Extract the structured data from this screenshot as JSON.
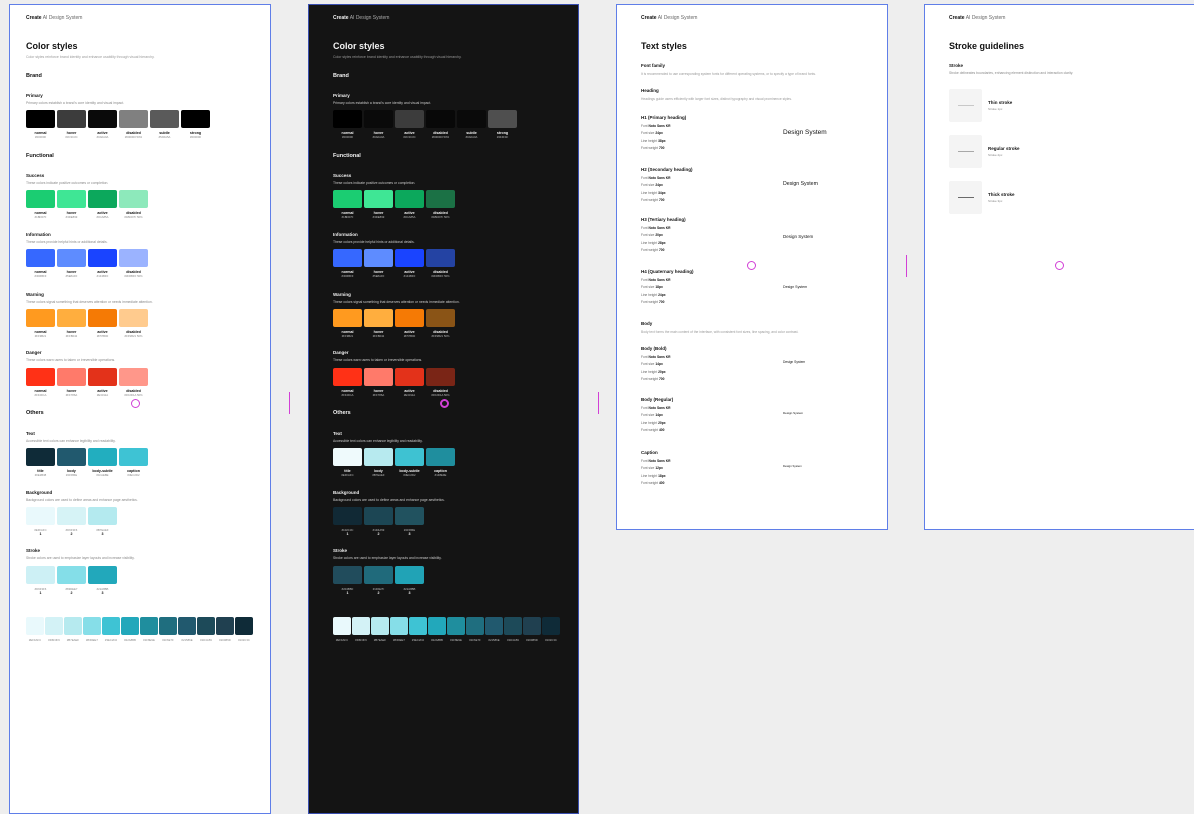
{
  "breadcrumb": {
    "brand": "Create",
    "path": "AI Design System"
  },
  "color": {
    "title": "Color styles",
    "subtitle": "Color styles reinforce brand identity and enhance usability through visual hierarchy.",
    "brand_title": "Brand",
    "functional_title": "Functional",
    "others_title": "Others"
  },
  "light": {
    "primary": {
      "name": "Primary",
      "desc": "Primary colors establish a brand's core identity and visual impact.",
      "swatches": [
        {
          "label": "normal",
          "hex": "#000000",
          "color": "#000000"
        },
        {
          "label": "hover",
          "hex": "#3C3C3C",
          "color": "#3c3c3c"
        },
        {
          "label": "active",
          "hex": "#0A0A0A",
          "color": "#0a0a0a"
        },
        {
          "label": "disabled",
          "hex": "#000000 50%",
          "color": "#808080"
        },
        {
          "label": "subtle",
          "hex": "#5A5A5A",
          "color": "#5a5a5a"
        },
        {
          "label": "strong",
          "hex": "#000000",
          "color": "#000000"
        }
      ]
    },
    "success": {
      "name": "Success",
      "desc": "These colors indicate positive outcomes or completion.",
      "swatches": [
        {
          "label": "normal",
          "hex": "#1BD07F",
          "color": "#1bcd72"
        },
        {
          "label": "hover",
          "hex": "#3DE899",
          "color": "#3fe695"
        },
        {
          "label": "active",
          "hex": "#0CA85A",
          "color": "#0ca85c"
        },
        {
          "label": "disabled",
          "hex": "#1BD07F 50%",
          "color": "#8de9bb"
        }
      ]
    },
    "information": {
      "name": "Information",
      "desc": "These colors provide helpful hints or additional details.",
      "swatches": [
        {
          "label": "normal",
          "hex": "#3D6BFF",
          "color": "#3668ff"
        },
        {
          "label": "hover",
          "hex": "#5E8AFF",
          "color": "#5e8cff"
        },
        {
          "label": "active",
          "hex": "#1F4BFF",
          "color": "#1a44ff"
        },
        {
          "label": "disabled",
          "hex": "#3D6BFF 50%",
          "color": "#9bb3ff"
        }
      ]
    },
    "warning": {
      "name": "Warning",
      "desc": "These colors signal something that deserves attention or needs immediate attention.",
      "swatches": [
        {
          "label": "normal",
          "hex": "#FF9B21",
          "color": "#ff9a1f"
        },
        {
          "label": "hover",
          "hex": "#FFB042",
          "color": "#ffae3e"
        },
        {
          "label": "active",
          "hex": "#F57B00",
          "color": "#f57a05"
        },
        {
          "label": "disabled",
          "hex": "#FF9B21 50%",
          "color": "#ffcb8e"
        }
      ]
    },
    "danger": {
      "name": "Danger",
      "desc": "These colors warn users to taken or irreversible operations.",
      "swatches": [
        {
          "label": "normal",
          "hex": "#FF2D1A",
          "color": "#ff3116"
        },
        {
          "label": "hover",
          "hex": "#FF786A",
          "color": "#ff7a6a"
        },
        {
          "label": "active",
          "hex": "#E3311A",
          "color": "#e3321a"
        },
        {
          "label": "disabled",
          "hex": "#FF2D1A 50%",
          "color": "#ff978a"
        }
      ]
    },
    "text": {
      "name": "Text",
      "desc": "Accessible text colors can enhance legibility and readability.",
      "swatches": [
        {
          "label": "title",
          "hex": "#0E2B38",
          "color": "#0f2b38"
        },
        {
          "label": "body",
          "hex": "#21586E",
          "color": "#21596e"
        },
        {
          "label": "body-subtle",
          "hex": "#1FAEBE",
          "color": "#22aebf"
        },
        {
          "label": "caption",
          "hex": "#3EC2D2",
          "color": "#3ec3d4"
        }
      ]
    },
    "background": {
      "name": "Background",
      "desc": "Background colors are used to define areas and enhance page aesthetics.",
      "swatches": [
        {
          "label": "1",
          "hex": "#EFFAFC",
          "color": "#e9f9fc"
        },
        {
          "label": "2",
          "hex": "#D6F3F6",
          "color": "#d6f3f6"
        },
        {
          "label": "3",
          "hex": "#B7EAEF",
          "color": "#b4eaef"
        }
      ]
    },
    "stroke": {
      "name": "Stroke",
      "desc": "Stroke colors are used to emphasize layer layouts and increase visibility.",
      "swatches": [
        {
          "label": "1",
          "hex": "#D6F3F6",
          "color": "#cdf0f5"
        },
        {
          "label": "2",
          "hex": "#83DEE7",
          "color": "#84dee8"
        },
        {
          "label": "3",
          "hex": "#22A8BB",
          "color": "#22a8bb"
        }
      ]
    }
  },
  "dark": {
    "primary": {
      "name": "Primary",
      "desc": "Primary colors establish a brand's core identity and visual impact.",
      "swatches": [
        {
          "label": "normal",
          "hex": "#000000",
          "color": "#000000"
        },
        {
          "label": "hover",
          "hex": "#0A0A0A",
          "color": "#0a0a0a"
        },
        {
          "label": "active",
          "hex": "#3C3C3C",
          "color": "#3c3c3c"
        },
        {
          "label": "disabled",
          "hex": "#000000 50%",
          "color": "#080808"
        },
        {
          "label": "subtle",
          "hex": "#0A0A0A",
          "color": "#0a0a0a"
        },
        {
          "label": "strong",
          "hex": "#4F4F4F",
          "color": "#4f4f4f"
        }
      ]
    },
    "success": {
      "name": "Success",
      "desc": "These colors indicate positive outcomes or completion.",
      "swatches": [
        {
          "label": "normal",
          "hex": "#1BD07F",
          "color": "#1bcd72"
        },
        {
          "label": "hover",
          "hex": "#3DE899",
          "color": "#3fe695"
        },
        {
          "label": "active",
          "hex": "#0CA85A",
          "color": "#0ca85c"
        },
        {
          "label": "disabled",
          "hex": "#1BD07F 50%",
          "color": "#1b7145"
        }
      ]
    },
    "information": {
      "name": "Information",
      "desc": "These colors provide helpful hints or additional details.",
      "swatches": [
        {
          "label": "normal",
          "hex": "#3D6BFF",
          "color": "#3668ff"
        },
        {
          "label": "hover",
          "hex": "#5E8AFF",
          "color": "#5e8cff"
        },
        {
          "label": "active",
          "hex": "#1F4BFF",
          "color": "#1a44ff"
        },
        {
          "label": "disabled",
          "hex": "#3D6BFF 50%",
          "color": "#2443a3"
        }
      ]
    },
    "warning": {
      "name": "Warning",
      "desc": "These colors signal something that deserves attention or needs immediate attention.",
      "swatches": [
        {
          "label": "normal",
          "hex": "#FF9B21",
          "color": "#ff9a1f"
        },
        {
          "label": "hover",
          "hex": "#FFB042",
          "color": "#ffae3e"
        },
        {
          "label": "active",
          "hex": "#F57B00",
          "color": "#f57a05"
        },
        {
          "label": "disabled",
          "hex": "#FF9B21 50%",
          "color": "#8a5416"
        }
      ]
    },
    "danger": {
      "name": "Danger",
      "desc": "These colors warn users to taken or irreversible operations.",
      "swatches": [
        {
          "label": "normal",
          "hex": "#FF2D1A",
          "color": "#ff3116"
        },
        {
          "label": "hover",
          "hex": "#FF786A",
          "color": "#ff7a6a"
        },
        {
          "label": "active",
          "hex": "#E3311A",
          "color": "#e3321a"
        },
        {
          "label": "disabled",
          "hex": "#FF2D1A 50%",
          "color": "#7a2516"
        }
      ]
    },
    "text": {
      "name": "Text",
      "desc": "Accessible text colors can enhance legibility and readability.",
      "swatches": [
        {
          "label": "title",
          "hex": "#EFFAFC",
          "color": "#effafc"
        },
        {
          "label": "body",
          "hex": "#B7EAEF",
          "color": "#b7eaef"
        },
        {
          "label": "body-subtle",
          "hex": "#3EC2D2",
          "color": "#3ec2d2"
        },
        {
          "label": "caption",
          "hex": "#1F8E9E",
          "color": "#1f8e9e"
        }
      ]
    },
    "background": {
      "name": "Background",
      "desc": "Background colors are used to define areas and enhance page aesthetics.",
      "swatches": [
        {
          "label": "1",
          "hex": "#102C3C",
          "color": "#112935"
        },
        {
          "label": "2",
          "hex": "#1D4A59",
          "color": "#1c4654"
        },
        {
          "label": "3",
          "hex": "#21586E",
          "color": "#21525f"
        }
      ]
    },
    "stroke": {
      "name": "Stroke",
      "desc": "Stroke colors are used to emphasize layer layouts and increase visibility.",
      "swatches": [
        {
          "label": "1",
          "hex": "#204B5D",
          "color": "#214c5c"
        },
        {
          "label": "2",
          "hex": "#1F6E7F",
          "color": "#206a7b"
        },
        {
          "label": "3",
          "hex": "#22A8BB",
          "color": "#21a3b6"
        }
      ]
    }
  },
  "scale_light": [
    {
      "hex": "#EFFAFC",
      "color": "#e9f9fc"
    },
    {
      "hex": "#D6F3F6",
      "color": "#d3f2f6"
    },
    {
      "hex": "#B7EAEF",
      "color": "#b6eaef"
    },
    {
      "hex": "#83DEE7",
      "color": "#86dee8"
    },
    {
      "hex": "#3EC2D2",
      "color": "#3ec3d4"
    },
    {
      "hex": "#22A8BB",
      "color": "#22a8bb"
    },
    {
      "hex": "#1F8E9E",
      "color": "#1f8e9e"
    },
    {
      "hex": "#1F6E7F",
      "color": "#1f6e7f"
    },
    {
      "hex": "#21586E",
      "color": "#21596e"
    },
    {
      "hex": "#1D4A59",
      "color": "#1d4a59"
    },
    {
      "hex": "#204B5D",
      "color": "#204050"
    },
    {
      "hex": "#102C3C",
      "color": "#0f2b38"
    }
  ],
  "scale_dark": [
    {
      "hex": "#EFFAFC",
      "color": "#e9f9fc"
    },
    {
      "hex": "#D6F3F6",
      "color": "#d3f2f6"
    },
    {
      "hex": "#B7EAEF",
      "color": "#b6eaef"
    },
    {
      "hex": "#83DEE7",
      "color": "#86dee8"
    },
    {
      "hex": "#3EC2D2",
      "color": "#3ec3d4"
    },
    {
      "hex": "#22A8BB",
      "color": "#22a8bb"
    },
    {
      "hex": "#1F8E9E",
      "color": "#1f8e9e"
    },
    {
      "hex": "#1F6E7F",
      "color": "#1f6e7f"
    },
    {
      "hex": "#21586E",
      "color": "#21596e"
    },
    {
      "hex": "#1D4A59",
      "color": "#1d4a59"
    },
    {
      "hex": "#204B5D",
      "color": "#204050"
    },
    {
      "hex": "#102C3C",
      "color": "#0f2b38"
    }
  ],
  "text_styles": {
    "title": "Text styles",
    "font_family": {
      "name": "Font family",
      "desc": "It is recommended to use corresponding system fonts for different operating systems, or to specify a type of brand fonts."
    },
    "heading": {
      "name": "Heading",
      "desc": "Headings guide users efficiently with larger font sizes, distinct typography and visual prominence styles."
    },
    "body_intro": {
      "name": "Body",
      "desc": "Body text forms the main content of the interface, with consistent font sizes, line spacing, and color contrast."
    },
    "font_label": "Font",
    "size_label": "Font size",
    "lh_label": "Line height",
    "weight_label": "Font weight",
    "items": [
      {
        "name": "H1 (Primary heading)",
        "font": "Noto Sans KR",
        "size": "24px",
        "lh": "38px",
        "weight": "700",
        "sample": "Design System"
      },
      {
        "name": "H2 (Secondary heading)",
        "font": "Noto Sans KR",
        "size": "24px",
        "lh": "34px",
        "weight": "700",
        "sample": "Design System"
      },
      {
        "name": "H3 (Tertiary heading)",
        "font": "Noto Sans KR",
        "size": "20px",
        "lh": "28px",
        "weight": "700",
        "sample": "Design System"
      },
      {
        "name": "H4 (Quaternary heading)",
        "font": "Noto Sans KR",
        "size": "18px",
        "lh": "24px",
        "weight": "700",
        "sample": "Design System"
      },
      {
        "name": "Body (Bold)",
        "font": "Noto Sans KR",
        "size": "14px",
        "lh": "20px",
        "weight": "700",
        "sample": "Design System"
      },
      {
        "name": "Body (Regular)",
        "font": "Noto Sans KR",
        "size": "14px",
        "lh": "20px",
        "weight": "400",
        "sample": "Design System"
      },
      {
        "name": "Caption",
        "font": "Noto Sans KR",
        "size": "12px",
        "lh": "18px",
        "weight": "400",
        "sample": "Design System"
      }
    ]
  },
  "stroke_guide": {
    "title": "Stroke guidelines",
    "section": "Stroke",
    "desc": "Stroke delineates boundaries, enhancing element distinction and interaction clarity.",
    "items": [
      {
        "name": "Thin stroke",
        "desc": "Stroke 1px",
        "color": "#c8c8c8"
      },
      {
        "name": "Regular stroke",
        "desc": "Stroke 2px",
        "color": "#a8a8a8"
      },
      {
        "name": "Thick stroke",
        "desc": "Stroke 3px",
        "color": "#6a6a6a"
      }
    ]
  }
}
